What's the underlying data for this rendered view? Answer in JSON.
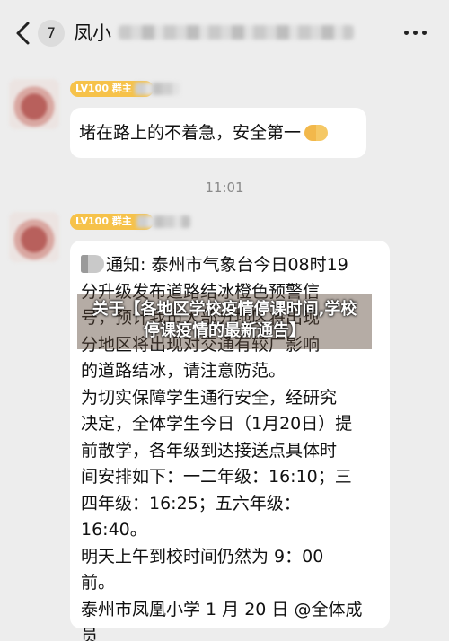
{
  "header": {
    "back_icon": "chevron-left-icon",
    "unread_count": "7",
    "chat_title": "凤小",
    "more_icon": "ellipsis-icon"
  },
  "messages": [
    {
      "rank_badge": "LV100 群主",
      "text": "堵在路上的不着急，安全第一",
      "emoji": "handshake-icon"
    },
    {
      "rank_badge": "LV100 群主",
      "lines": [
        "通知: 泰州市气象台今日08时19",
        "分升级发布道路结冰橙色预警信",
        "号，预计我市大部分地区将出现",
        "分地区将出现对交通有较广影响",
        "的道路结冰，请注意防范。",
        "为切实保障学生通行安全，经研究",
        "决定，全体学生今日（1月20日）提",
        "前散学，各年级到达接送点具体时",
        "间安排如下：一二年级：16:10；三",
        "四年级：16:25；五六年级：",
        "16:40。",
        "明天上午到校时间仍然为 9：00",
        "前。",
        "泰州市凤凰小学 1 月 20 日 @全体成",
        "员"
      ]
    }
  ],
  "time_divider": "11:01",
  "overlay_caption": {
    "line1": "关于【各地区学校疫情停课时间,学校",
    "line2": "停课疫情的最新通告】"
  }
}
